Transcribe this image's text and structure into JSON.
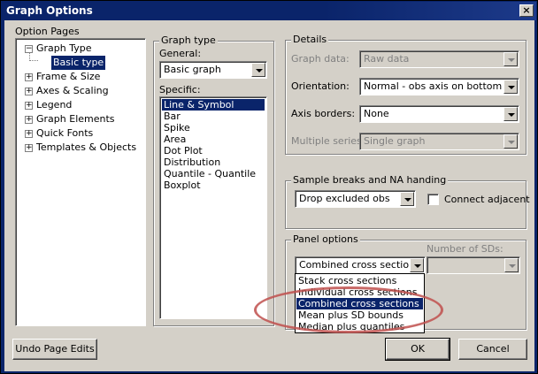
{
  "window": {
    "title": "Graph Options",
    "close_glyph": "×"
  },
  "option_pages": {
    "label": "Option Pages",
    "tree": [
      {
        "label": "Graph Type",
        "toggle": "−"
      },
      {
        "label": "Basic type"
      },
      {
        "label": "Frame & Size",
        "toggle": "+"
      },
      {
        "label": "Axes & Scaling",
        "toggle": "+"
      },
      {
        "label": "Legend",
        "toggle": "+"
      },
      {
        "label": "Graph Elements",
        "toggle": "+"
      },
      {
        "label": "Quick Fonts",
        "toggle": "+"
      },
      {
        "label": "Templates & Objects",
        "toggle": "+"
      }
    ],
    "selected": "Basic type"
  },
  "graph_type": {
    "group_label": "Graph type",
    "general_label": "General:",
    "general_value": "Basic graph",
    "specific_label": "Specific:",
    "specific_items": [
      "Line & Symbol",
      "Bar",
      "Spike",
      "Area",
      "Dot Plot",
      "Distribution",
      "Quantile - Quantile",
      "Boxplot"
    ],
    "specific_selected": "Line & Symbol"
  },
  "details": {
    "group_label": "Details",
    "graph_data_label": "Graph data:",
    "graph_data_value": "Raw data",
    "orientation_label": "Orientation:",
    "orientation_value": "Normal - obs axis on bottom",
    "axis_borders_label": "Axis borders:",
    "axis_borders_value": "None",
    "multiple_series_label": "Multiple series:",
    "multiple_series_value": "Single graph"
  },
  "sample_breaks": {
    "group_label": "Sample breaks and NA handing",
    "value": "Drop excluded obs",
    "connect_label": "Connect adjacent",
    "connect_checked": false
  },
  "panel_options": {
    "group_label": "Panel options",
    "value": "Combined cross sections",
    "number_sds_label": "Number of SDs:",
    "dropdown_items": [
      "Stack cross sections",
      "Individual cross sections",
      "Combined cross sections",
      "Mean plus SD bounds",
      "Median plus quantiles"
    ],
    "dropdown_selected": "Combined cross sections"
  },
  "buttons": {
    "undo": "Undo Page Edits",
    "ok": "OK",
    "cancel": "Cancel"
  },
  "colors": {
    "title_bar": "#0a246a",
    "face": "#d4d0c8",
    "highlight_ellipse": "#c0504d"
  }
}
